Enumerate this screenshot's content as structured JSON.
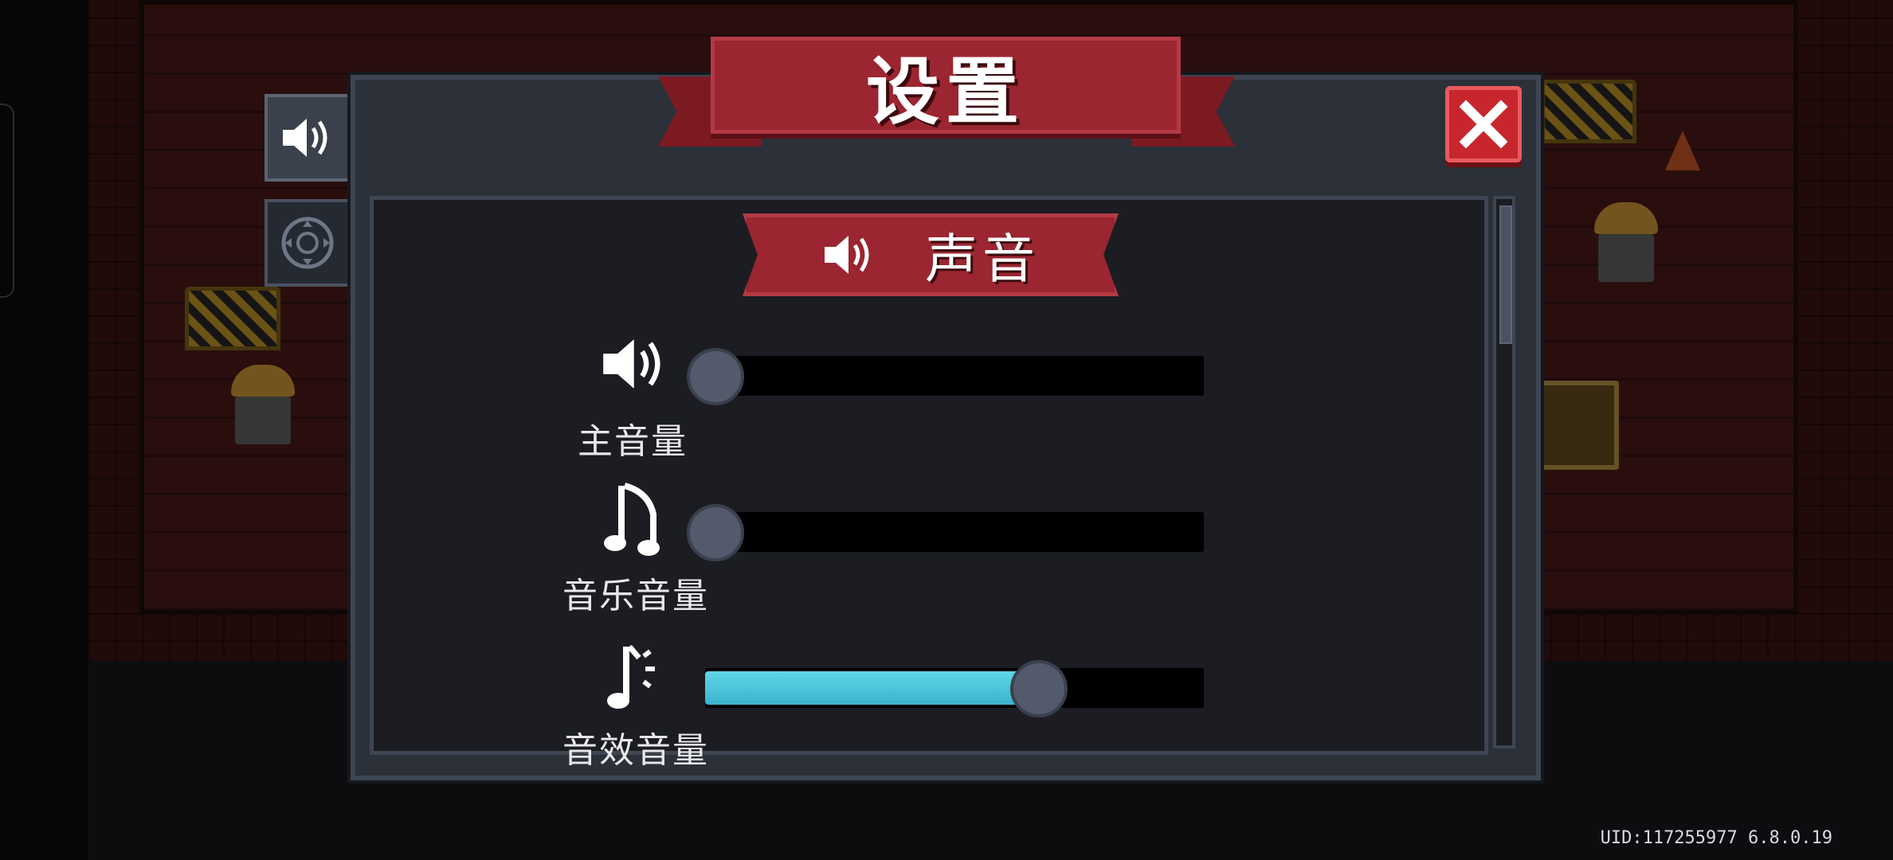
{
  "dialog": {
    "title": "设置",
    "close_icon": "close-x-icon"
  },
  "tabs": [
    {
      "icon": "speaker-icon",
      "active": true
    },
    {
      "icon": "joystick-icon",
      "active": false
    }
  ],
  "section": {
    "icon": "speaker-icon",
    "title": "声音"
  },
  "volume": {
    "master": {
      "label": "主音量",
      "icon": "speaker-icon",
      "level": 0.02
    },
    "music": {
      "label": "音乐音量",
      "icon": "music-note-icon",
      "level": 0.02
    },
    "sfx": {
      "label": "音效音量",
      "icon": "sfx-note-icon",
      "level": 0.67
    }
  },
  "footer": {
    "uid": "UID:117255977 6.8.0.19"
  },
  "colors": {
    "panel": "#2b3039",
    "ribbon": "#9b2530",
    "close": "#c7262d",
    "slider_fill": "#4ac3d9"
  }
}
